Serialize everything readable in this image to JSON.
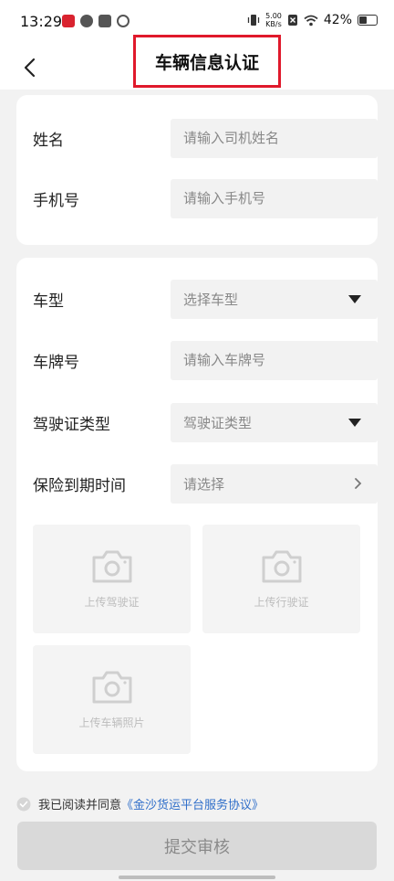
{
  "status_bar": {
    "time": "13:29",
    "net_speed_value": "5.00",
    "net_speed_unit": "KB/s",
    "battery": "42%"
  },
  "nav": {
    "title": "车辆信息认证",
    "back_icon": "chevron-left-icon"
  },
  "driver_info": {
    "name_label": "姓名",
    "name_placeholder": "请输入司机姓名",
    "phone_label": "手机号",
    "phone_placeholder": "请输入手机号"
  },
  "vehicle_info": {
    "type_label": "车型",
    "type_value": "选择车型",
    "plate_label": "车牌号",
    "plate_placeholder": "请输入车牌号",
    "license_type_label": "驾驶证类型",
    "license_type_value": "驾驶证类型",
    "insurance_label": "保险到期时间",
    "insurance_value": "请选择"
  },
  "uploads": [
    {
      "label": "上传驾驶证"
    },
    {
      "label": "上传行驶证"
    },
    {
      "label": "上传车辆照片"
    }
  ],
  "agreement": {
    "prefix": "我已阅读并同意",
    "link": "《金沙货运平台服务协议》"
  },
  "submit_label": "提交审核",
  "colors": {
    "background": "#f2f2f2",
    "card": "#ffffff",
    "highlight_border": "#e0192b",
    "link": "#2f6ec9",
    "submit_disabled": "#d9d9d9"
  }
}
